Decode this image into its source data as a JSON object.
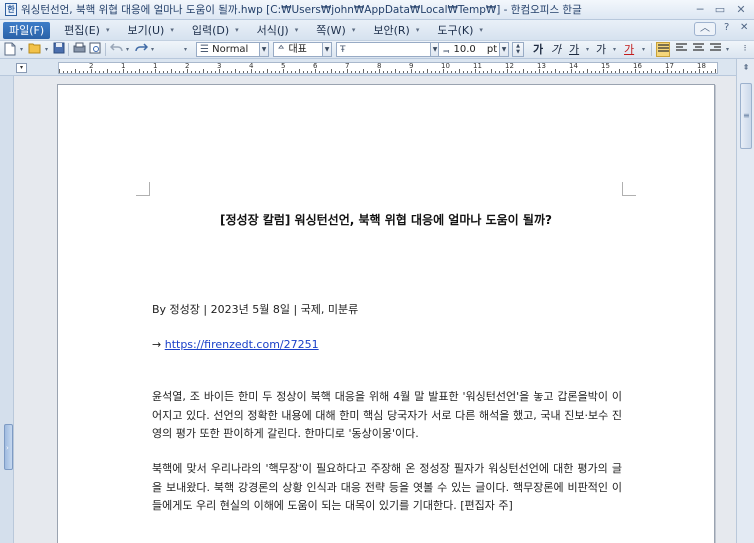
{
  "window": {
    "title": "워싱턴선언, 북핵 위협 대응에 얼마나 도움이 될까.hwp [C:₩Users₩john₩AppData₩Local₩Temp₩] - 한컴오피스 한글",
    "minimize": "─",
    "restore": "▭",
    "close": "✕"
  },
  "menu": {
    "items": [
      {
        "label": "파일(F)"
      },
      {
        "label": "편집(E)"
      },
      {
        "label": "보기(U)"
      },
      {
        "label": "입력(D)"
      },
      {
        "label": "서식(J)"
      },
      {
        "label": "쪽(W)"
      },
      {
        "label": "보안(R)"
      },
      {
        "label": "도구(K)"
      }
    ],
    "arrow": "▾",
    "ribbon_toggle": "︿",
    "help": "?",
    "close": "✕"
  },
  "toolbar": {
    "style_value": "Normal",
    "font_name_value": "대표",
    "font_face_value": "",
    "font_size_value": "10.0",
    "font_size_unit": "pt",
    "bold": "가",
    "italic": "가",
    "underline": "가",
    "strike": "가",
    "text_color": "가"
  },
  "ruler": {
    "numbers": [
      "2",
      "1",
      "1",
      "2",
      "3",
      "4",
      "5",
      "6",
      "7",
      "8",
      "9",
      "10",
      "11",
      "12",
      "13",
      "14",
      "15",
      "16",
      "17",
      "18"
    ]
  },
  "document": {
    "title": "[정성장 칼럼] 워싱턴선언, 북핵 위협 대응에 얼마나 도움이 될까?",
    "byline": "By 정성장 | 2023년 5월 8일 | 국제, 미분류",
    "link_prefix": "→",
    "link_url": "https://firenzedt.com/27251",
    "paragraph1": "윤석열, 조 바이든 한미 두 정상이 북핵 대응을 위해 4월 말 발표한 '워싱턴선언'을 놓고 갑론을박이 이어지고 있다. 선언의 정확한 내용에 대해 한미 핵심 당국자가 서로 다른 해석을 했고, 국내 진보·보수 진영의 평가 또한 판이하게 갈린다. 한마디로 '동상이몽'이다.",
    "paragraph2": "북핵에 맞서 우리나라의 '핵무장'이 필요하다고 주장해 온 정성장 필자가 워싱턴선언에 대한 평가의 글을 보내왔다. 북핵 강경론의 상황 인식과 대응 전략 등을 엿볼 수 있는 글이다. 핵무장론에 비판적인 이들에게도 우리 현실의 이해에 도움이 되는 대목이 있기를 기대한다. [편집자 주]"
  },
  "colors": {
    "menu_active": "#2a62a8",
    "link": "#1b41c8",
    "spell_underline": "#e03a3a"
  }
}
